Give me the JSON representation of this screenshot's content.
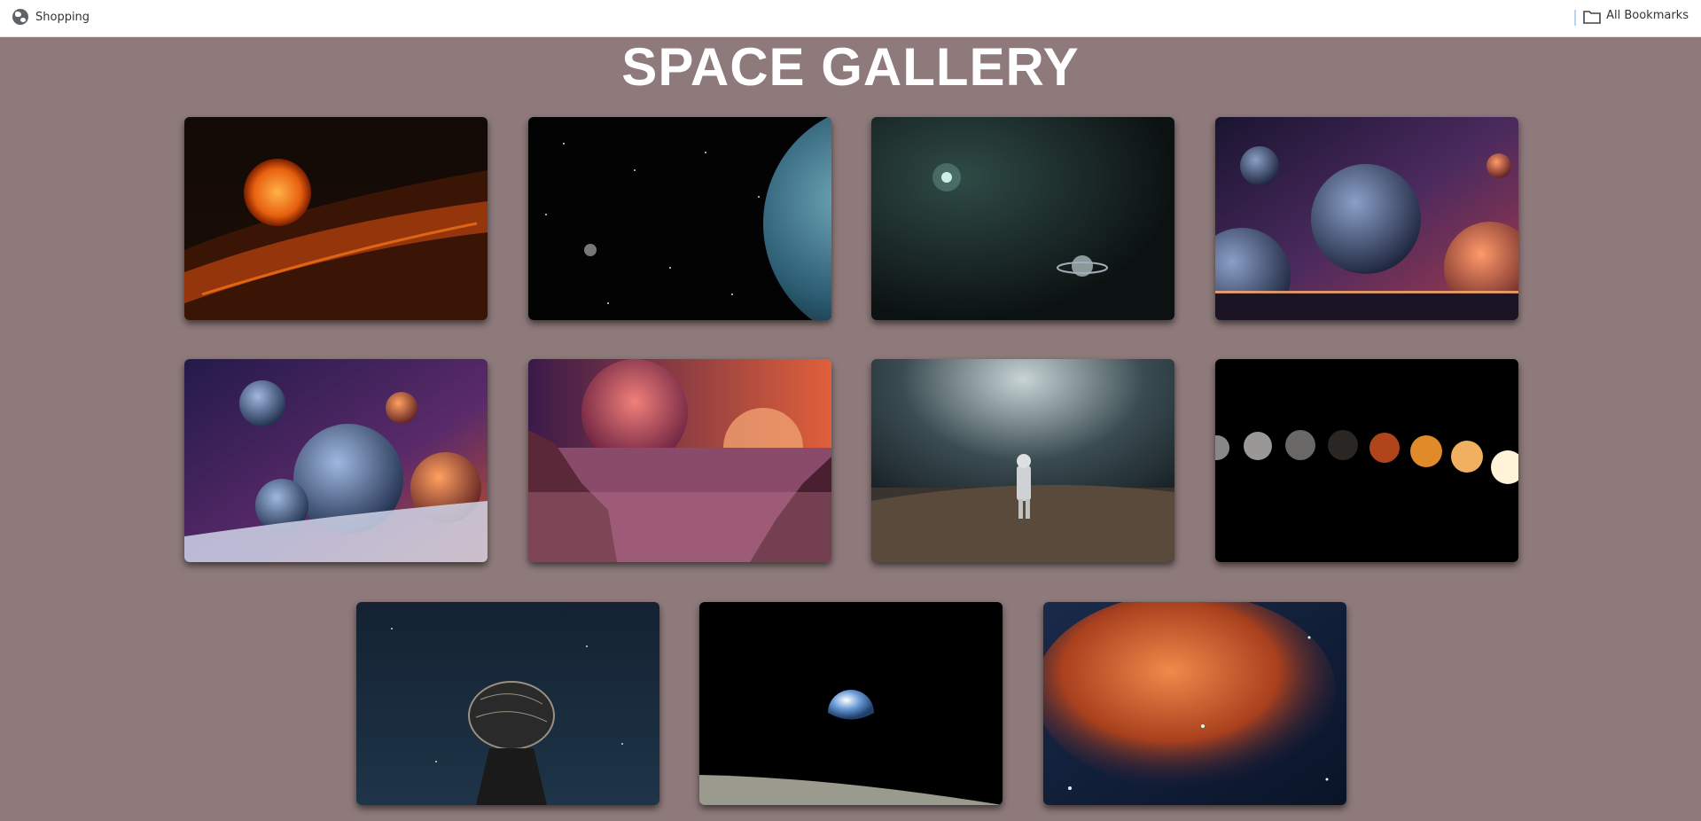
{
  "bookmarks_bar": {
    "left_item": {
      "label": "Shopping",
      "icon": "globe-icon"
    },
    "right_item": {
      "label": "All Bookmarks",
      "icon": "folder-icon"
    }
  },
  "page": {
    "title": "SPACE GALLERY",
    "background": "#8e7a7b"
  },
  "gallery": {
    "images": [
      {
        "subject": "fiery orange planet over burning clouds"
      },
      {
        "subject": "earth edge with starfield"
      },
      {
        "subject": "dark nebula with ringed planet"
      },
      {
        "subject": "colorful planets over horizon"
      },
      {
        "subject": "purple nebula with several planets"
      },
      {
        "subject": "alien desert with giant planets"
      },
      {
        "subject": "astronaut on rocky planet"
      },
      {
        "subject": "moon phases row"
      },
      {
        "subject": "radio telescope dish under stars"
      },
      {
        "subject": "earthrise over lunar surface"
      },
      {
        "subject": "orange and blue nebula"
      }
    ]
  }
}
